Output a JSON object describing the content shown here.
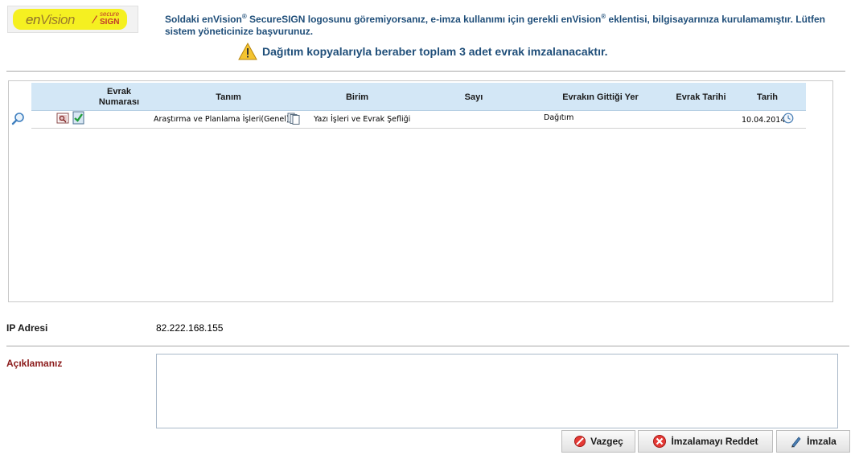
{
  "logo": {
    "brand_prefix": "en",
    "brand_main": "Vision",
    "tag_top": "secure",
    "tag_bottom": "SIGN"
  },
  "notice_text": "Soldaki enVision® SecureSIGN logosunu göremiyorsanız, e-imza kullanımı için gerekli enVision® eklentisi, bilgisayarınıza kurulamamıştır. Lütfen sistem yöneticinize başvurunuz.",
  "alert_text": "Dağıtım kopyalarıyla beraber toplam 3 adet evrak imzalanacaktır.",
  "table": {
    "columns": [
      "Evrak Numarası",
      "Tanım",
      "Birim",
      "Sayı",
      "Evrakın Gittiği Yer",
      "Evrak Tarihi",
      "Tarih"
    ],
    "rows": [
      {
        "evrak_numarasi": "",
        "tanim": "Araştırma ve Planlama İşleri(Genel)",
        "birim": "Yazı İşleri ve Evrak Şefliği",
        "sayi": "",
        "gittigi_yer": "Dağıtım",
        "evrak_tarihi": "",
        "tarih": "10.04.2014"
      }
    ]
  },
  "ip": {
    "label": "IP Adresi",
    "value": "82.222.168.155"
  },
  "aciklama": {
    "label": "Açıklamanız",
    "value": "",
    "placeholder": ""
  },
  "buttons": {
    "cancel": "Vazgeç",
    "reject": "İmzalamayı Reddet",
    "sign": "İmzala"
  },
  "colors": {
    "header_bg": "#d3e7f6",
    "text_blue": "#1f4e79",
    "label_red": "#8b1a1a",
    "logo_yellow": "#f5f021"
  }
}
